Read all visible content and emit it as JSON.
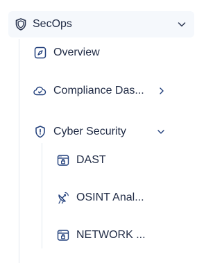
{
  "section": {
    "label": "SecOps",
    "icon": "shield-icon",
    "expanded": true
  },
  "items": [
    {
      "label": "Overview",
      "icon": "compass-icon"
    },
    {
      "label": "Compliance Das...",
      "icon": "cloud-icon",
      "has_children": true,
      "expanded": false
    },
    {
      "label": "Cyber Security",
      "icon": "shield-alert-icon",
      "has_children": true,
      "expanded": true,
      "children": [
        {
          "label": "DAST",
          "icon": "browser-lock-icon"
        },
        {
          "label": "OSINT Anal...",
          "icon": "satellite-dish-icon"
        },
        {
          "label": "NETWORK ...",
          "icon": "browser-lock-icon"
        }
      ]
    }
  ],
  "colors": {
    "text": "#1f2a44",
    "icon": "#1f3d7a",
    "header_bg": "#f5f8fc",
    "tree_line": "#e3e8ef"
  }
}
